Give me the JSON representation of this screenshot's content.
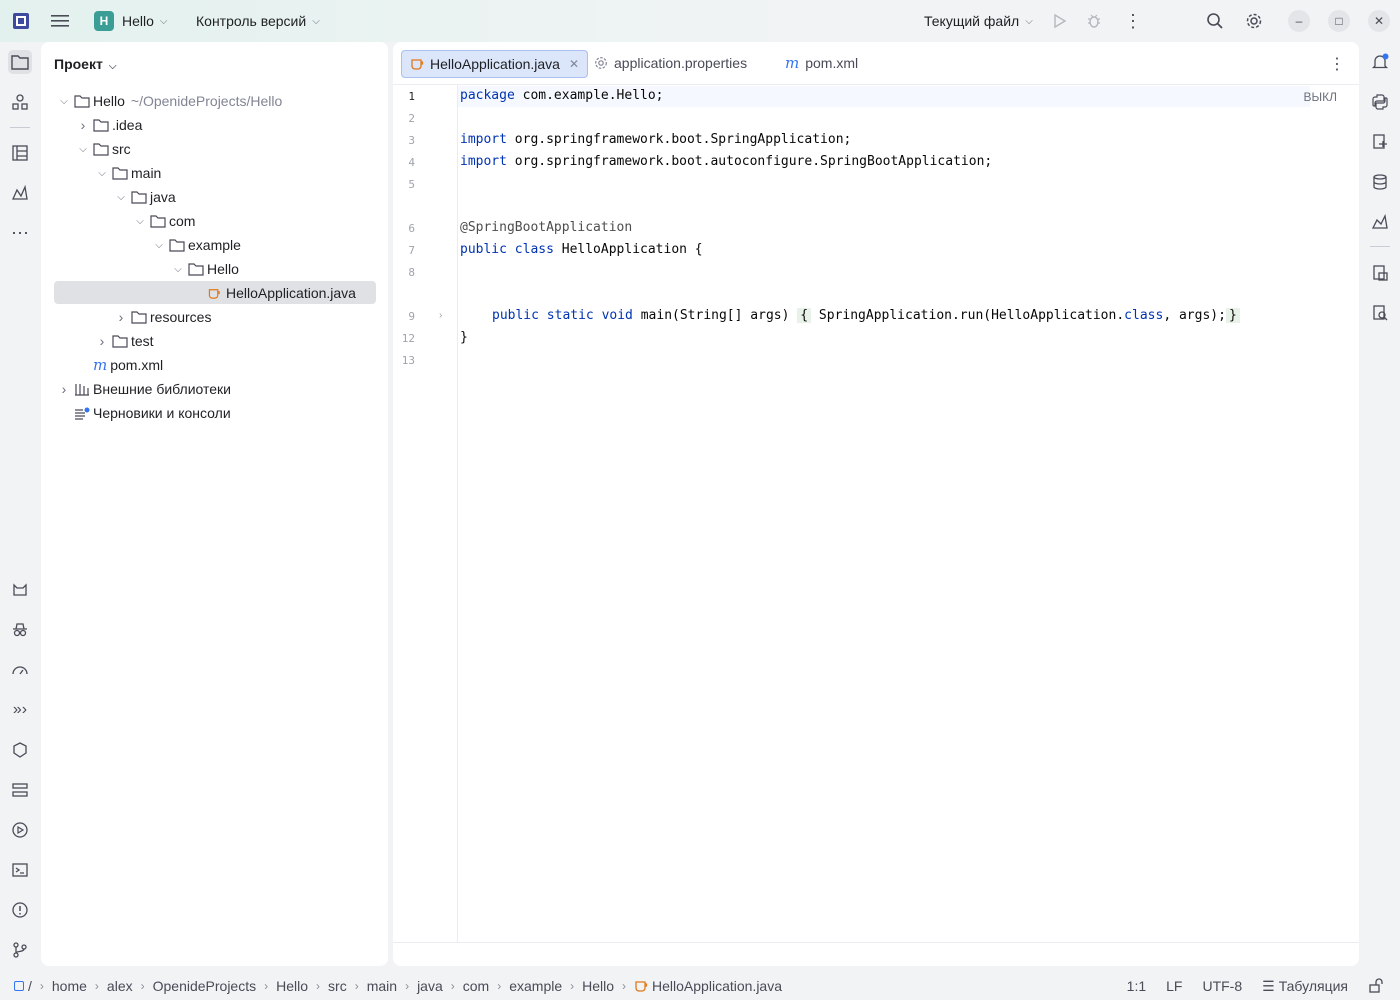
{
  "titlebar": {
    "project_badge": "H",
    "project_name": "Hello",
    "vcs": "Контроль версий",
    "run_config": "Текущий файл"
  },
  "project_panel": {
    "title": "Проект",
    "tree": [
      {
        "label": "Hello",
        "hint": "~/OpenideProjects/Hello",
        "depth": 0,
        "expanded": true,
        "icon": "folder-icon"
      },
      {
        "label": ".idea",
        "depth": 1,
        "expanded": false,
        "icon": "folder-icon"
      },
      {
        "label": "src",
        "depth": 1,
        "expanded": true,
        "icon": "folder-icon"
      },
      {
        "label": "main",
        "depth": 2,
        "expanded": true,
        "icon": "folder-icon"
      },
      {
        "label": "java",
        "depth": 3,
        "expanded": true,
        "icon": "folder-icon"
      },
      {
        "label": "com",
        "depth": 4,
        "expanded": true,
        "icon": "folder-icon"
      },
      {
        "label": "example",
        "depth": 5,
        "expanded": true,
        "icon": "folder-icon"
      },
      {
        "label": "Hello",
        "depth": 6,
        "expanded": true,
        "icon": "folder-icon"
      },
      {
        "label": "HelloApplication.java",
        "depth": 7,
        "selected": true,
        "icon": "java-class-icon"
      },
      {
        "label": "resources",
        "depth": 3,
        "expanded": false,
        "icon": "folder-icon"
      },
      {
        "label": "test",
        "depth": 2,
        "expanded": false,
        "icon": "folder-icon"
      },
      {
        "label": "pom.xml",
        "depth": 1,
        "icon": "maven-icon"
      },
      {
        "label": "Внешние библиотеки",
        "depth": 0,
        "expanded": false,
        "icon": "library-icon"
      },
      {
        "label": "Черновики и консоли",
        "depth": 0,
        "icon": "scratches-icon"
      }
    ]
  },
  "editor": {
    "tabs": [
      {
        "label": "HelloApplication.java",
        "active": true,
        "icon": "java-class-icon"
      },
      {
        "label": "application.properties",
        "active": false,
        "icon": "gear-icon"
      },
      {
        "label": "pom.xml",
        "active": false,
        "icon": "maven-icon"
      }
    ],
    "readonly_label": "ВЫКЛ",
    "line_numbers": [
      "1",
      "2",
      "3",
      "4",
      "5",
      "6",
      "7",
      "8",
      "9",
      "12",
      "13"
    ],
    "lines": {
      "l1_kw": "package",
      "l1_rest": " com.example.Hello;",
      "l3_kw": "import",
      "l3_rest": " org.springframework.boot.SpringApplication;",
      "l4_kw": "import",
      "l4_rest": " org.springframework.boot.autoconfigure.SpringBootApplication;",
      "l6": "@SpringBootApplication",
      "l7_kw": "public class",
      "l7_rest": " HelloApplication {",
      "l9_kw": "public static void",
      "l9_a": " main(String[] args) ",
      "l9_open": "{",
      "l9_b": " SpringApplication.run(HelloApplication.",
      "l9_kw2": "class",
      "l9_c": ", args);",
      "l9_close": "}",
      "l12": "}"
    }
  },
  "statusbar": {
    "breadcrumbs": [
      "home",
      "alex",
      "OpenideProjects",
      "Hello",
      "src",
      "main",
      "java",
      "com",
      "example",
      "Hello",
      "HelloApplication.java"
    ],
    "root": "/",
    "position": "1:1",
    "line_sep": "LF",
    "encoding": "UTF-8",
    "indent": "Табуляция"
  },
  "colors": {
    "keyword": "#0033b3",
    "accent": "#3574f0",
    "badge": "#3b9e96"
  }
}
